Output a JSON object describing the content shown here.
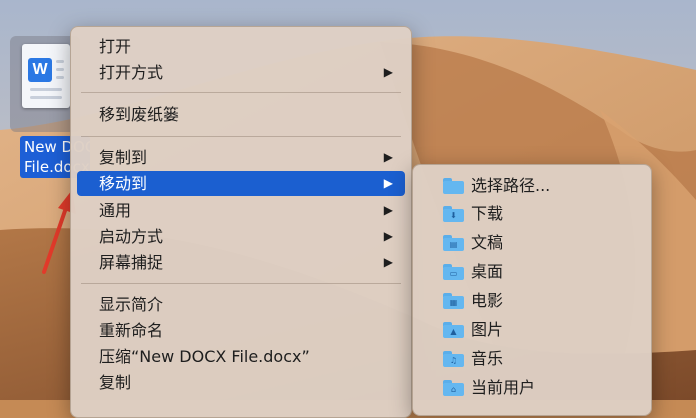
{
  "file": {
    "icon_letter": "W",
    "name_lines": [
      "New DOCX",
      "File.docx"
    ]
  },
  "main_menu": {
    "items": [
      {
        "label": "打开",
        "has_submenu": false,
        "highlighted": false
      },
      {
        "label": "打开方式",
        "has_submenu": true,
        "highlighted": false
      },
      {
        "label": "移到废纸篓",
        "has_submenu": false,
        "highlighted": false
      },
      {
        "label": "复制到",
        "has_submenu": true,
        "highlighted": false
      },
      {
        "label": "移动到",
        "has_submenu": true,
        "highlighted": true
      },
      {
        "label": "通用",
        "has_submenu": true,
        "highlighted": false
      },
      {
        "label": "启动方式",
        "has_submenu": true,
        "highlighted": false
      },
      {
        "label": "屏幕捕捉",
        "has_submenu": true,
        "highlighted": false
      },
      {
        "label": "显示简介",
        "has_submenu": false,
        "highlighted": false
      },
      {
        "label": "重新命名",
        "has_submenu": false,
        "highlighted": false
      },
      {
        "label": "压缩“New DOCX File.docx”",
        "has_submenu": false,
        "highlighted": false
      },
      {
        "label": "复制",
        "has_submenu": false,
        "highlighted": false
      }
    ],
    "submenu_glyph": "▶"
  },
  "move_to_submenu": {
    "items": [
      {
        "label": "选择路径...",
        "icon": "folder-icon"
      },
      {
        "label": "下载",
        "icon": "downloads-folder-icon"
      },
      {
        "label": "文稿",
        "icon": "documents-folder-icon"
      },
      {
        "label": "桌面",
        "icon": "desktop-folder-icon"
      },
      {
        "label": "电影",
        "icon": "movies-folder-icon"
      },
      {
        "label": "图片",
        "icon": "pictures-folder-icon"
      },
      {
        "label": "音乐",
        "icon": "music-folder-icon"
      },
      {
        "label": "当前用户",
        "icon": "home-folder-icon"
      }
    ]
  },
  "colors": {
    "highlight": "#1b5fd0",
    "folder": "#64b7f0",
    "annotation_arrow": "#e23a2a"
  }
}
